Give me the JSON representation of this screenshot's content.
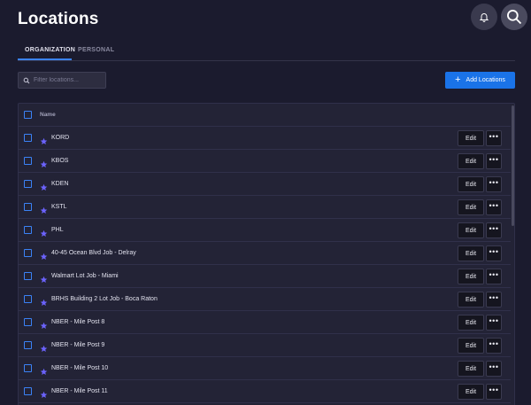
{
  "page": {
    "title": "Locations"
  },
  "tabs": [
    {
      "label": "ORGANIZATION",
      "active": true
    },
    {
      "label": "PERSONAL",
      "active": false
    }
  ],
  "filter": {
    "placeholder": "Filter locations...",
    "value": ""
  },
  "add_button": {
    "label": "Add Locations"
  },
  "table": {
    "header": {
      "name": "Name"
    },
    "action_label": "Edit",
    "more_label": "•••",
    "rows": [
      {
        "name": "KORD"
      },
      {
        "name": "KBOS"
      },
      {
        "name": "KDEN"
      },
      {
        "name": "KSTL"
      },
      {
        "name": "PHL"
      },
      {
        "name": "40-45 Ocean Blvd Job - Delray"
      },
      {
        "name": "Walmart Lot Job - Miami"
      },
      {
        "name": "BRHS Building 2 Lot Job - Boca Raton"
      },
      {
        "name": "NBER - Mile Post 8"
      },
      {
        "name": "NBER - Mile Post 9"
      },
      {
        "name": "NBER - Mile Post 10"
      },
      {
        "name": "NBER - Mile Post 11"
      }
    ]
  },
  "colors": {
    "accent": "#1a73e8",
    "star": "#6c63ff",
    "background": "#1b1b2e"
  }
}
